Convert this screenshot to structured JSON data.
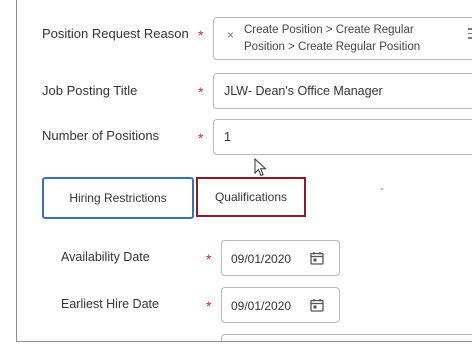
{
  "form": {
    "position_request_reason": {
      "label": "Position Request Reason",
      "required_mark": "*",
      "selected_line1": "Create Position > Create Regular",
      "selected_line2": "Position > Create Regular Position",
      "remove_symbol": "×"
    },
    "job_posting_title": {
      "label": "Job Posting Title",
      "required_mark": "*",
      "value": "JLW- Dean's Office Manager"
    },
    "number_of_positions": {
      "label": "Number of Positions",
      "required_mark": "*",
      "value": "1"
    }
  },
  "tabs": {
    "hiring_restrictions": "Hiring Restrictions",
    "qualifications": "Qualifications"
  },
  "hiring_restrictions": {
    "availability_date": {
      "label": "Availability Date",
      "required_mark": "*",
      "value": "09/01/2020"
    },
    "earliest_hire_date": {
      "label": "Earliest Hire Date",
      "required_mark": "*",
      "value": "09/01/2020"
    }
  },
  "icons": {
    "list": "list-icon",
    "calendar": "calendar-icon",
    "cursor": "mouse-pointer-icon"
  },
  "colors": {
    "required": "#d22b2b",
    "active_tab_border": "#3b6fb6",
    "highlight_border": "#8b1a2b"
  }
}
